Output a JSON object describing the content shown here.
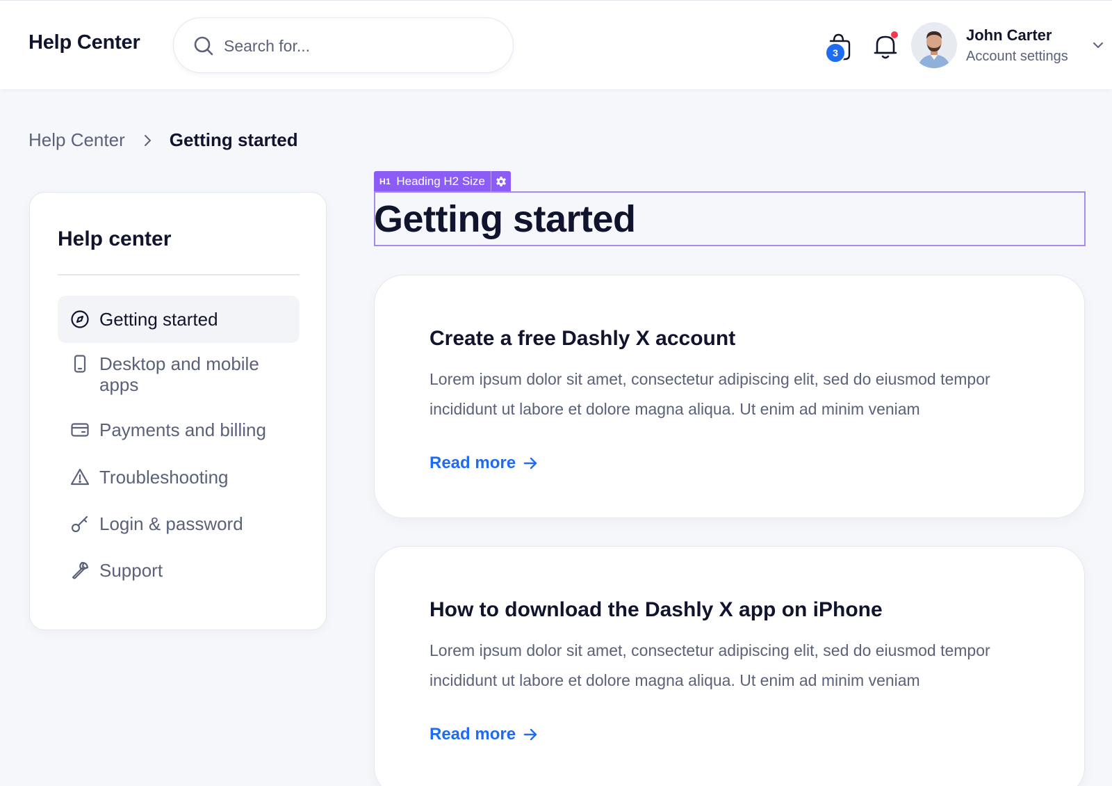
{
  "header": {
    "brand": "Help Center",
    "search_placeholder": "Search for...",
    "cart_count": "3",
    "user_name": "John Carter",
    "user_subtitle": "Account settings"
  },
  "breadcrumb": {
    "root": "Help Center",
    "current": "Getting started"
  },
  "sidebar": {
    "title": "Help center",
    "items": [
      {
        "label": "Getting started",
        "icon": "compass-icon",
        "active": true
      },
      {
        "label": "Desktop and mobile apps",
        "icon": "phone-icon",
        "active": false
      },
      {
        "label": "Payments and billing",
        "icon": "credit-card-icon",
        "active": false
      },
      {
        "label": "Troubleshooting",
        "icon": "warning-icon",
        "active": false
      },
      {
        "label": "Login & password",
        "icon": "key-icon",
        "active": false
      },
      {
        "label": "Support",
        "icon": "wrench-icon",
        "active": false
      }
    ]
  },
  "editor": {
    "tag_marker": "H1",
    "tag_label": "Heading H2 Size"
  },
  "main": {
    "title": "Getting started",
    "articles": [
      {
        "title": "Create a free Dashly X account",
        "body": "Lorem ipsum dolor sit amet, consectetur adipiscing elit, sed do eiusmod tempor incididunt ut labore et dolore magna aliqua. Ut enim ad minim veniam",
        "link": "Read more"
      },
      {
        "title": "How to download the Dashly X app on iPhone",
        "body": "Lorem ipsum dolor sit amet, consectetur adipiscing elit, sed do eiusmod tempor incididunt ut labore et dolore magna aliqua. Ut enim ad minim veniam",
        "link": "Read more"
      }
    ]
  },
  "colors": {
    "accent_blue": "#1f6bf2",
    "editor_purple": "#8b5cf6",
    "notification_red": "#f2394d",
    "text_dark": "#11142d",
    "text_muted": "#5b6178",
    "background": "#f6f7fb"
  }
}
